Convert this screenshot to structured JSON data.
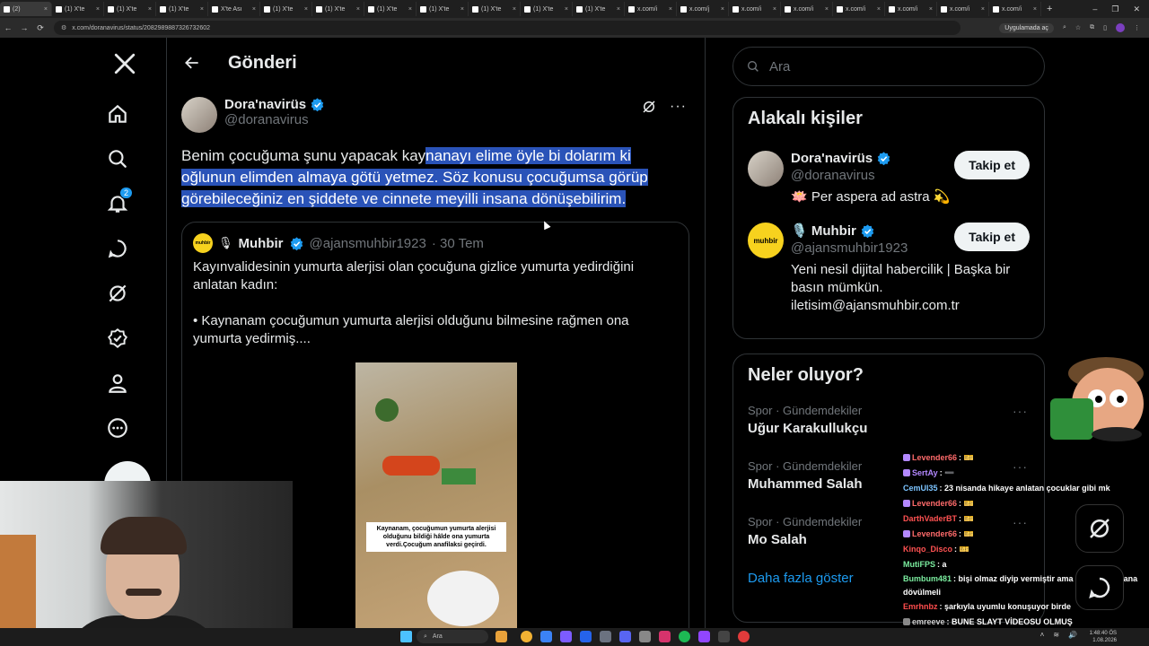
{
  "browser": {
    "tabs": [
      {
        "label": "(2)"
      },
      {
        "label": "(1) X'te"
      },
      {
        "label": "(1) X'te"
      },
      {
        "label": "(1) X'te"
      },
      {
        "label": "X'te Ası"
      },
      {
        "label": "(1) X'te"
      },
      {
        "label": "(1) X'te"
      },
      {
        "label": "(1) X'te"
      },
      {
        "label": "(1) X'te"
      },
      {
        "label": "(1) X'te"
      },
      {
        "label": "(1) X'te"
      },
      {
        "label": "(1) X'te"
      },
      {
        "label": "x.com/i"
      },
      {
        "label": "x.com/j"
      },
      {
        "label": "x.com/i"
      },
      {
        "label": "x.com/i"
      },
      {
        "label": "x.com/i"
      },
      {
        "label": "x.com/i"
      },
      {
        "label": "x.com/i"
      },
      {
        "label": "x.com/i"
      }
    ],
    "url": "x.com/doranavirus/status/2082989887326732602",
    "app_button": "Uygulamada aç"
  },
  "leftnav": {
    "notification_count": "2"
  },
  "header": {
    "title": "Gönderi"
  },
  "tweet": {
    "author_name": "Dora'navirüs",
    "author_handle": "@doranavirus",
    "text_plain": "Benim çocuğuma şunu yapacak kay",
    "text_selected": "nanayı elime öyle bi dolarım ki oğlunun elimden almaya götü yetmez. Söz konusu çocuğumsa görüp görebileceğiniz en şiddete ve cinnete meyilli insana dönüşebilirim.",
    "quote": {
      "author_name": "Muhbir",
      "author_handle": "@ajansmuhbir1923",
      "time": "· 30 Tem",
      "logo_text": "muhbir",
      "paragraph1": "Kayınvalidesinin yumurta alerjisi olan çocuğuna gizlice yumurta yedirdiğini anlatan kadın:",
      "paragraph2": "• Kaynanam çocuğumun yumurta alerjisi olduğunu bilmesine rağmen ona yumurta yedirmiş....",
      "media_caption": "Kaynanam, çocuğumun yumurta alerjisi olduğunu bildiği hâlde ona yumurta verdi.Çocuğum anafilaksi geçirdi."
    }
  },
  "search": {
    "placeholder": "Ara"
  },
  "related": {
    "title": "Alakalı kişiler",
    "people": [
      {
        "name": "Dora'navirüs",
        "handle": "@doranavirus",
        "bio": "🪷 Per aspera ad astra 💫",
        "follow_label": "Takip et"
      },
      {
        "name": "🎙️ Muhbir",
        "handle": "@ajansmuhbir1923",
        "bio": "Yeni nesil dijital habercilik | Başka bir basın mümkün. iletisim@ajansmuhbir.com.tr",
        "follow_label": "Takip et",
        "logo_text": "muhbir"
      }
    ]
  },
  "trends": {
    "title": "Neler oluyor?",
    "items": [
      {
        "category": "Spor · Gündemdekiler",
        "title": "Uğur Karakullukçu"
      },
      {
        "category": "Spor · Gündemdekiler",
        "title": "Muhammed Salah"
      },
      {
        "category": "Spor · Gündemdekiler",
        "title": "Mo Salah"
      }
    ],
    "show_more": "Daha fazla göster"
  },
  "chat": [
    {
      "user": "Levender66",
      "msg": ": 🎫",
      "color": "#ff6b6b"
    },
    {
      "user": "SertAy",
      "msg": ": ➖",
      "color": "#b388ff"
    },
    {
      "user": "CemUl35",
      "msg": ": 23 nisanda hikaye anlatan çocuklar gibi mk",
      "color": "#7cc4ff"
    },
    {
      "user": "Levender66",
      "msg": ": 🎫",
      "color": "#ff6b6b"
    },
    {
      "user": "DarthVaderBT",
      "msg": ": 🎫",
      "color": "#ff5252"
    },
    {
      "user": "Levender66",
      "msg": ": 🎫",
      "color": "#ff6b6b"
    },
    {
      "user": "Kinqo_Disco",
      "msg": ": 🎫",
      "color": "#ff5252"
    },
    {
      "user": "MutiFPS",
      "msg": ": a",
      "color": "#7bed9f"
    },
    {
      "user": "Bumbum481",
      "msg": ": bişi olmaz diyip vermiştir ama orospu kaynana dövülmeli",
      "color": "#7bed9f"
    },
    {
      "user": "Emrhnbz",
      "msg": ": şarkıyla uyumlu konuşuyor birde",
      "color": "#ff4d4d"
    },
    {
      "user": "emreeve",
      "msg": ": BUNE SLAYT VİDEOSU OLMUŞ",
      "color": "#cfcfcf"
    }
  ],
  "taskbar": {
    "search_placeholder": "Ara",
    "time": "1:48:40 ÖS",
    "date": "1.08.2026"
  },
  "colors": {
    "accent": "#1d9bf0",
    "selection": "#2a53b8",
    "background": "#000000"
  }
}
